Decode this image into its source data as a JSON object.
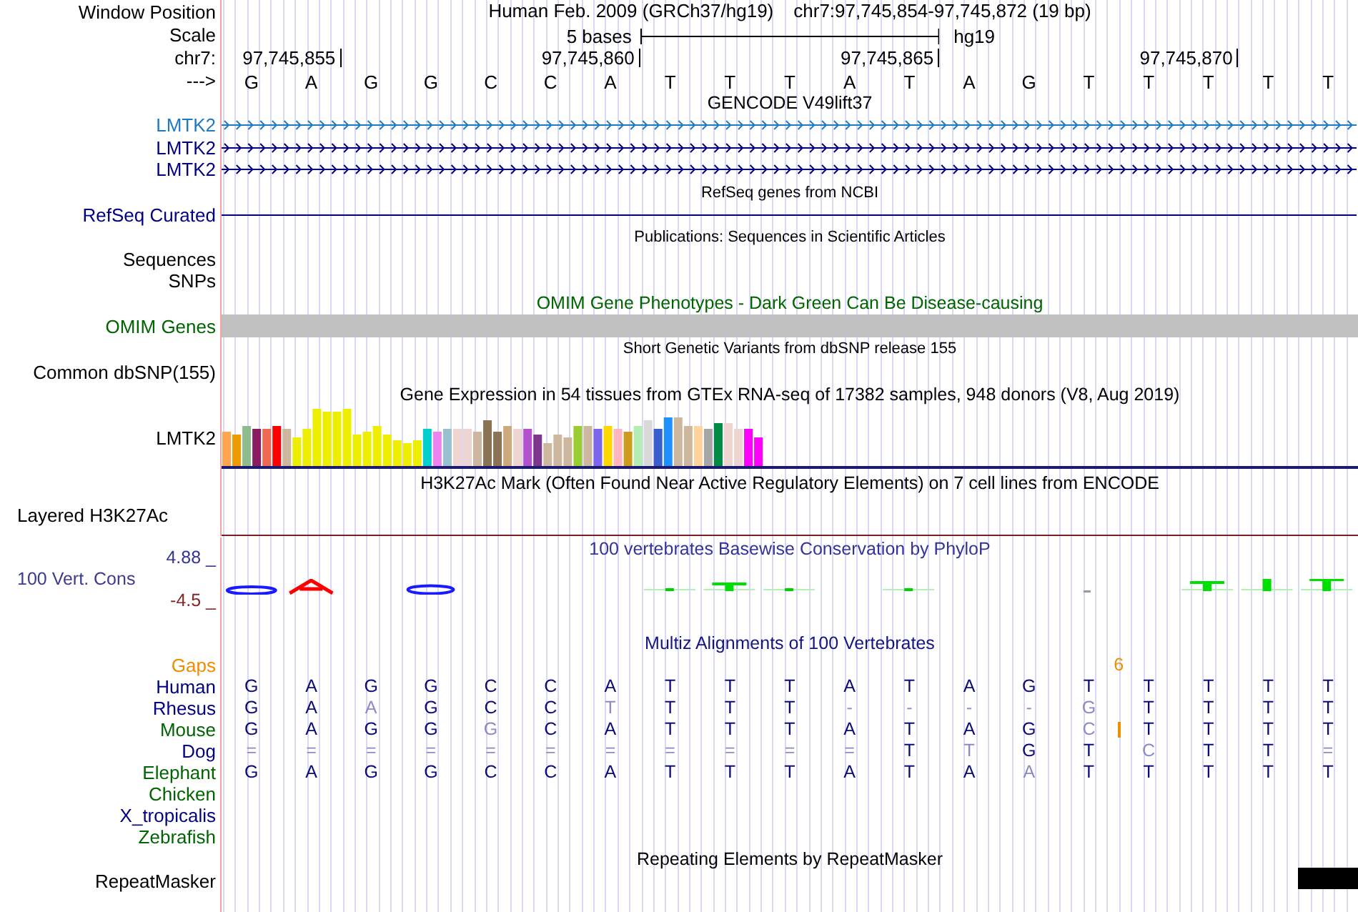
{
  "position": {
    "label": "Window Position",
    "assembly": "Human Feb. 2009 (GRCh37/hg19)",
    "range": "chr7:97,745,854-97,745,872 (19 bp)"
  },
  "scale": {
    "label": "Scale",
    "span": "5 bases",
    "assembly": "hg19"
  },
  "coordinates": {
    "label": "chr7:",
    "ticks": [
      "97,745,855",
      "97,745,860",
      "97,745,865",
      "97,745,870"
    ]
  },
  "sequence": {
    "label": "--->",
    "bases": [
      "G",
      "A",
      "G",
      "G",
      "C",
      "C",
      "A",
      "T",
      "T",
      "T",
      "A",
      "T",
      "A",
      "G",
      "T",
      "T",
      "T",
      "T",
      "T"
    ]
  },
  "tracks": [
    {
      "kind": "gene",
      "title": "GENCODE V49lift37",
      "rows": [
        {
          "label": "LMTK2",
          "color": "#1f7bc1"
        },
        {
          "label": "LMTK2",
          "color": "#000080"
        },
        {
          "label": "LMTK2",
          "color": "#000080"
        }
      ]
    },
    {
      "kind": "gene_line",
      "title": "RefSeq genes from NCBI",
      "rows": [
        {
          "label": "RefSeq Curated",
          "color": "#000080"
        }
      ]
    },
    {
      "kind": "empty",
      "title": "Publications: Sequences in Scientific Articles",
      "rows": [
        {
          "label": "Sequences"
        },
        {
          "label": "SNPs"
        }
      ]
    },
    {
      "kind": "omim",
      "title": "OMIM Gene Phenotypes - Dark Green Can Be Disease-causing",
      "rows": [
        {
          "label": "OMIM Genes"
        }
      ]
    },
    {
      "kind": "empty",
      "title": "Short Genetic Variants from dbSNP release 155",
      "rows": [
        {
          "label": "Common dbSNP(155)"
        }
      ]
    },
    {
      "kind": "gtex",
      "title": "Gene Expression in 54 tissues from GTEx RNA-seq of 17382 samples, 948 donors (V8, Aug 2019)",
      "rows": [
        {
          "label": "LMTK2"
        }
      ]
    },
    {
      "kind": "h3k27ac",
      "title": "H3K27Ac Mark (Often Found Near Active Regulatory Elements) on 7 cell lines from ENCODE",
      "rows": [
        {
          "label": "Layered H3K27Ac"
        }
      ]
    },
    {
      "kind": "conservation",
      "title": "100 vertebrates Basewise Conservation by PhyloP",
      "label": "100 Vert. Cons",
      "max": "4.88 _",
      "min": "-4.5 _"
    },
    {
      "kind": "alignment",
      "title": "Multiz Alignments of 100 Vertebrates",
      "gaps_label": "Gaps",
      "species": [
        {
          "name": "Human",
          "color": "#000080",
          "cells": [
            {
              "base": "G",
              "faint": false
            },
            {
              "base": "A",
              "faint": false
            },
            {
              "base": "G",
              "faint": false
            },
            {
              "base": "G",
              "faint": false
            },
            {
              "base": "C",
              "faint": false
            },
            {
              "base": "C",
              "faint": false
            },
            {
              "base": "A",
              "faint": false
            },
            {
              "base": "T",
              "faint": false
            },
            {
              "base": "T",
              "faint": false
            },
            {
              "base": "T",
              "faint": false
            },
            {
              "base": "A",
              "faint": false
            },
            {
              "base": "T",
              "faint": false
            },
            {
              "base": "A",
              "faint": false
            },
            {
              "base": "G",
              "faint": false
            },
            {
              "base": "T",
              "faint": false
            },
            {
              "base": "T",
              "faint": false
            },
            {
              "base": "T",
              "faint": false
            },
            {
              "base": "T",
              "faint": false
            },
            {
              "base": "T",
              "faint": false
            }
          ]
        },
        {
          "name": "Rhesus",
          "color": "#000080",
          "cells": [
            {
              "base": "G",
              "faint": false
            },
            {
              "base": "A",
              "faint": false
            },
            {
              "base": "A",
              "faint": true
            },
            {
              "base": "G",
              "faint": false
            },
            {
              "base": "C",
              "faint": false
            },
            {
              "base": "C",
              "faint": false
            },
            {
              "base": "T",
              "faint": true
            },
            {
              "base": "T",
              "faint": false
            },
            {
              "base": "T",
              "faint": false
            },
            {
              "base": "T",
              "faint": false
            },
            {
              "base": "-",
              "faint": true
            },
            {
              "base": "-",
              "faint": true
            },
            {
              "base": "-",
              "faint": true
            },
            {
              "base": "-",
              "faint": true
            },
            {
              "base": "G",
              "faint": true
            },
            {
              "base": "T",
              "faint": false
            },
            {
              "base": "T",
              "faint": false
            },
            {
              "base": "T",
              "faint": false
            },
            {
              "base": "T",
              "faint": false
            }
          ]
        },
        {
          "name": "Mouse",
          "color": "#006400",
          "cells": [
            {
              "base": "G",
              "faint": false
            },
            {
              "base": "A",
              "faint": false
            },
            {
              "base": "G",
              "faint": false
            },
            {
              "base": "G",
              "faint": false
            },
            {
              "base": "G",
              "faint": true
            },
            {
              "base": "C",
              "faint": false
            },
            {
              "base": "A",
              "faint": false
            },
            {
              "base": "T",
              "faint": false
            },
            {
              "base": "T",
              "faint": false
            },
            {
              "base": "T",
              "faint": false
            },
            {
              "base": "A",
              "faint": false
            },
            {
              "base": "T",
              "faint": false
            },
            {
              "base": "A",
              "faint": false
            },
            {
              "base": "G",
              "faint": false
            },
            {
              "base": "C",
              "faint": true,
              "insertion": "6"
            },
            {
              "base": "T",
              "faint": false
            },
            {
              "base": "T",
              "faint": false
            },
            {
              "base": "T",
              "faint": false
            },
            {
              "base": "T",
              "faint": false
            }
          ]
        },
        {
          "name": "Dog",
          "color": "#000080",
          "cells": [
            {
              "base": "=",
              "faint": true
            },
            {
              "base": "=",
              "faint": true
            },
            {
              "base": "=",
              "faint": true
            },
            {
              "base": "=",
              "faint": true
            },
            {
              "base": "=",
              "faint": true
            },
            {
              "base": "=",
              "faint": true
            },
            {
              "base": "=",
              "faint": true
            },
            {
              "base": "=",
              "faint": true
            },
            {
              "base": "=",
              "faint": true
            },
            {
              "base": "=",
              "faint": true
            },
            {
              "base": "=",
              "faint": true
            },
            {
              "base": "T",
              "faint": false
            },
            {
              "base": "T",
              "faint": true
            },
            {
              "base": "G",
              "faint": false
            },
            {
              "base": "T",
              "faint": false
            },
            {
              "base": "C",
              "faint": true
            },
            {
              "base": "T",
              "faint": false
            },
            {
              "base": "T",
              "faint": false
            },
            {
              "base": "=",
              "faint": true
            }
          ]
        },
        {
          "name": "Elephant",
          "color": "#006400",
          "cells": [
            {
              "base": "G",
              "faint": false
            },
            {
              "base": "A",
              "faint": false
            },
            {
              "base": "G",
              "faint": false
            },
            {
              "base": "G",
              "faint": false
            },
            {
              "base": "C",
              "faint": false
            },
            {
              "base": "C",
              "faint": false
            },
            {
              "base": "A",
              "faint": false
            },
            {
              "base": "T",
              "faint": false
            },
            {
              "base": "T",
              "faint": false
            },
            {
              "base": "T",
              "faint": false
            },
            {
              "base": "A",
              "faint": false
            },
            {
              "base": "T",
              "faint": false
            },
            {
              "base": "A",
              "faint": false
            },
            {
              "base": "A",
              "faint": true
            },
            {
              "base": "T",
              "faint": false
            },
            {
              "base": "T",
              "faint": false
            },
            {
              "base": "T",
              "faint": false
            },
            {
              "base": "T",
              "faint": false
            },
            {
              "base": "T",
              "faint": false
            }
          ]
        },
        {
          "name": "Chicken",
          "color": "#006400"
        },
        {
          "name": "X_tropicalis",
          "color": "#000080"
        },
        {
          "name": "Zebrafish",
          "color": "#006400"
        }
      ]
    },
    {
      "kind": "repeat",
      "title": "Repeating Elements by RepeatMasker",
      "rows": [
        {
          "label": "RepeatMasker"
        }
      ]
    }
  ]
}
